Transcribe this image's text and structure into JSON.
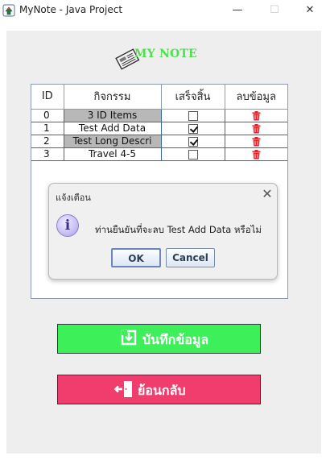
{
  "window": {
    "title": "MyNote - Java Project",
    "min_glyph": "—",
    "max_glyph": "☐",
    "close_glyph": "✕"
  },
  "logo": {
    "text": "MY NOTE",
    "icon": "newspaper-icon",
    "color": "#4ee04e"
  },
  "table": {
    "columns": [
      "ID",
      "กิจกรรม",
      "เสร็จสิ้น",
      "ลบข้อมูล"
    ],
    "rows": [
      {
        "id": "0",
        "activity": "3 ID Items",
        "done": false,
        "selected": true
      },
      {
        "id": "1",
        "activity": "Test Add Data",
        "done": true,
        "selected": false
      },
      {
        "id": "2",
        "activity": "Test Long Descri",
        "done": true,
        "selected": true
      },
      {
        "id": "3",
        "activity": "Travel 4-5",
        "done": false,
        "selected": false
      }
    ]
  },
  "dialog": {
    "title": "แจ้งเตือน",
    "close_glyph": "✕",
    "icon": "info-icon",
    "icon_glyph": "i",
    "message": "ท่านยืนยันที่จะลบ Test Add Data หรือไม่",
    "ok_label": "OK",
    "cancel_label": "Cancel"
  },
  "buttons": {
    "save_label": "บันทึกข้อมูล",
    "back_label": "ย้อนกลับ",
    "save_color": "#3df05a",
    "back_color": "#f03d6e"
  }
}
